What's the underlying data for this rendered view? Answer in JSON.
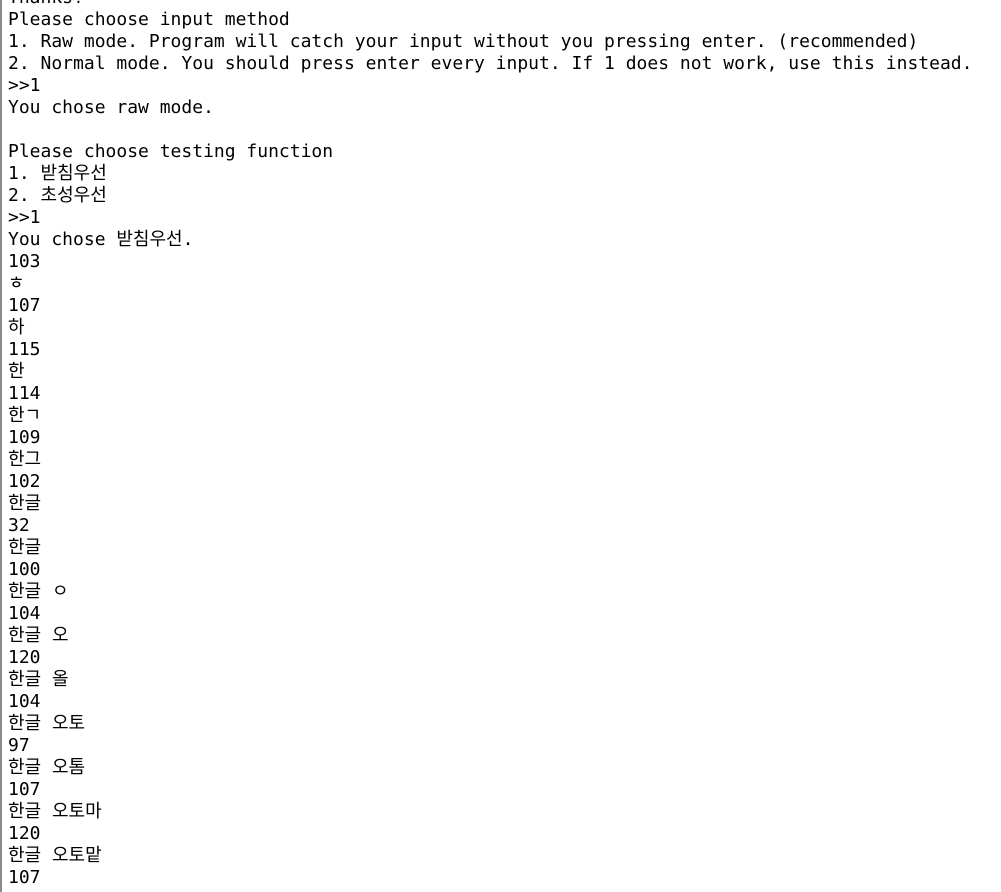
{
  "terminal": {
    "lines": [
      "Thanks!",
      "Please choose input method",
      "1. Raw mode. Program will catch your input without you pressing enter. (recommended)",
      "2. Normal mode. You should press enter every input. If 1 does not work, use this instead.",
      ">>1",
      "You chose raw mode.",
      "",
      "Please choose testing function",
      "1. 받침우선",
      "2. 초성우선",
      ">>1",
      "You chose 받침우선.",
      "103",
      "ㅎ",
      "107",
      "하",
      "115",
      "한",
      "114",
      "한ㄱ",
      "109",
      "한그",
      "102",
      "한글",
      "32",
      "한글",
      "100",
      "한글 ㅇ",
      "104",
      "한글 오",
      "120",
      "한글 올",
      "104",
      "한글 오토",
      "97",
      "한글 오톰",
      "107",
      "한글 오토마",
      "120",
      "한글 오토맡",
      "107"
    ]
  }
}
